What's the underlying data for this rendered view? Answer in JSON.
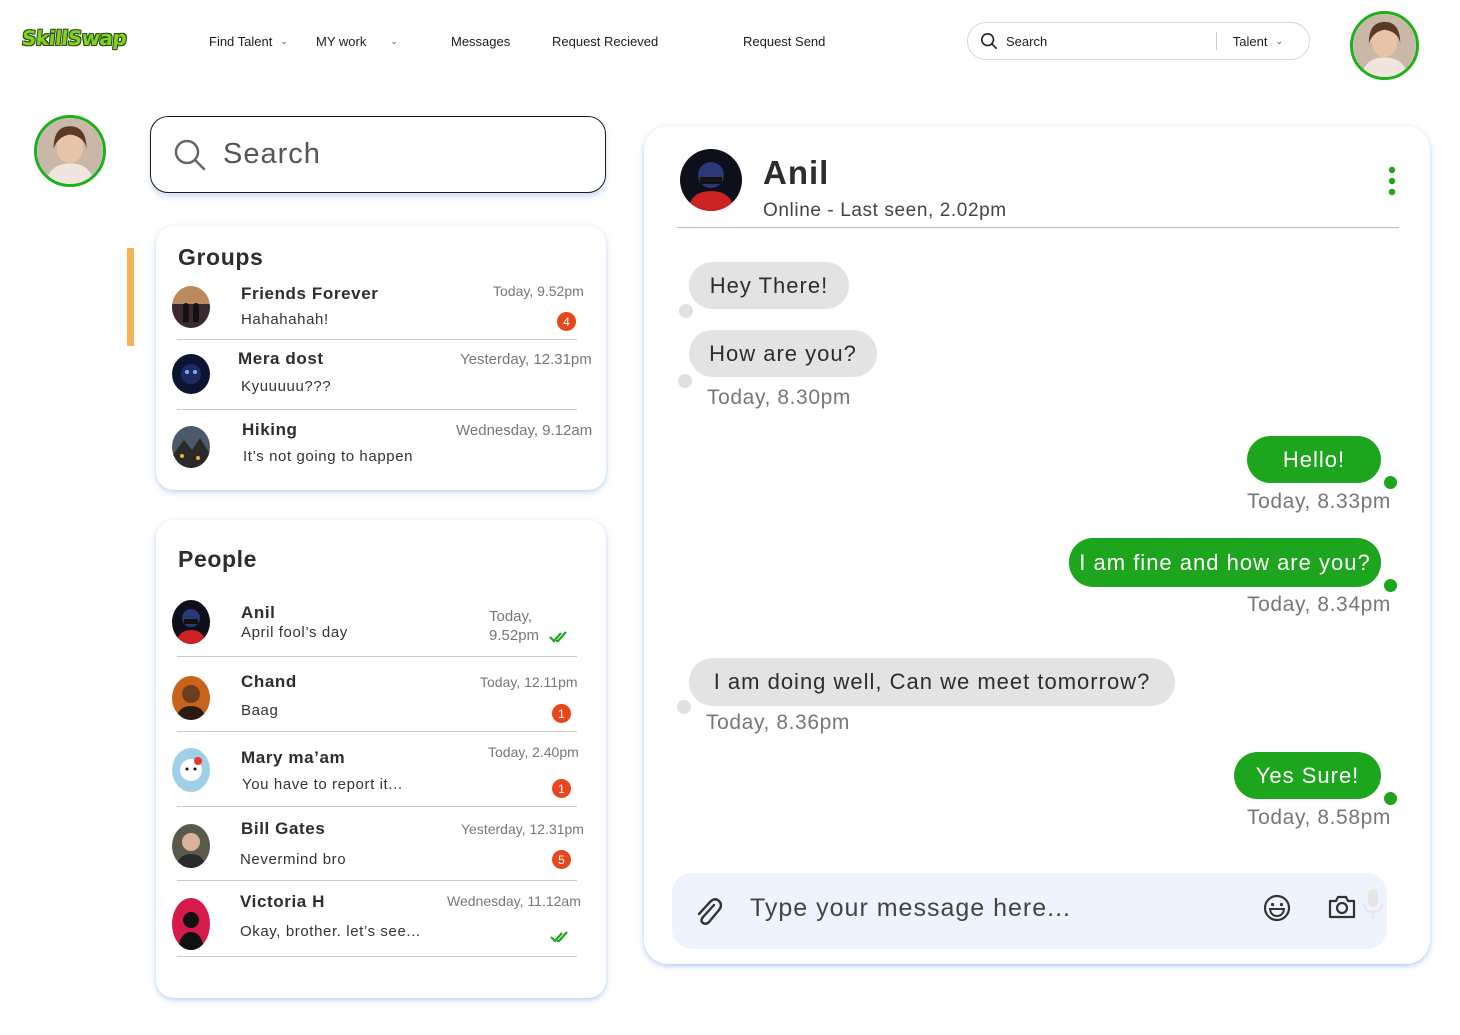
{
  "brand": {
    "logo_text": "SkillSwap"
  },
  "nav": {
    "find_talent": "Find Talent",
    "my_work": "MY work",
    "messages": "Messages",
    "request_received": "Request Recieved",
    "request_send": "Request Send"
  },
  "top_search": {
    "label": "Search",
    "scope": "Talent"
  },
  "sidebar_search": {
    "placeholder": "Search"
  },
  "groups": {
    "title": "Groups",
    "items": [
      {
        "name": "Friends Forever",
        "message": "Hahahahah!",
        "time": "Today, 9.52pm",
        "unread": "4"
      },
      {
        "name": "Mera dost",
        "message": "Kyuuuuu???",
        "time": "Yesterday, 12.31pm"
      },
      {
        "name": "Hiking",
        "message": "It’s not going to happen",
        "time": "Wednesday, 9.12am"
      }
    ]
  },
  "people": {
    "title": "People",
    "items": [
      {
        "name": "Anil",
        "message": "April fool’s day",
        "time_line1": "Today,",
        "time_line2": "9.52pm",
        "status": "read"
      },
      {
        "name": "Chand",
        "message": "Baag",
        "time": "Today, 12.11pm",
        "unread": "1"
      },
      {
        "name": "Mary ma’am",
        "message": "You have to report it...",
        "time": "Today, 2.40pm",
        "unread": "1"
      },
      {
        "name": "Bill Gates",
        "message": "Nevermind bro",
        "time": "Yesterday, 12.31pm",
        "unread": "5"
      },
      {
        "name": "Victoria H",
        "message": "Okay, brother. let’s see...",
        "time": "Wednesday, 11.12am",
        "status": "read"
      }
    ]
  },
  "chat": {
    "contact_name": "Anil",
    "contact_status": "Online - Last seen, 2.02pm",
    "messages": [
      {
        "direction": "in",
        "text": "Hey There!"
      },
      {
        "direction": "in",
        "text": "How are you?",
        "time": "Today, 8.30pm"
      },
      {
        "direction": "out",
        "text": "Hello!",
        "time": "Today, 8.33pm"
      },
      {
        "direction": "out",
        "text": "I am fine and how are you?",
        "time": "Today, 8.34pm"
      },
      {
        "direction": "in",
        "text": "I am doing well, Can we meet tomorrow?",
        "time": "Today, 8.36pm"
      },
      {
        "direction": "out",
        "text": "Yes Sure!",
        "time": "Today, 8.58pm"
      }
    ],
    "input_placeholder": "Type your message here..."
  },
  "colors": {
    "accent_green": "#1ea51e",
    "badge_orange": "#e8461b",
    "incoming_bubble": "#e3e3e3",
    "highlight_bar": "#f4b254",
    "input_bg": "#eef4fd"
  },
  "icons": [
    "search-icon",
    "chevron-down-icon",
    "more-vertical-icon",
    "attachment-icon",
    "emoji-icon",
    "camera-icon",
    "microphone-icon",
    "double-check-icon"
  ]
}
